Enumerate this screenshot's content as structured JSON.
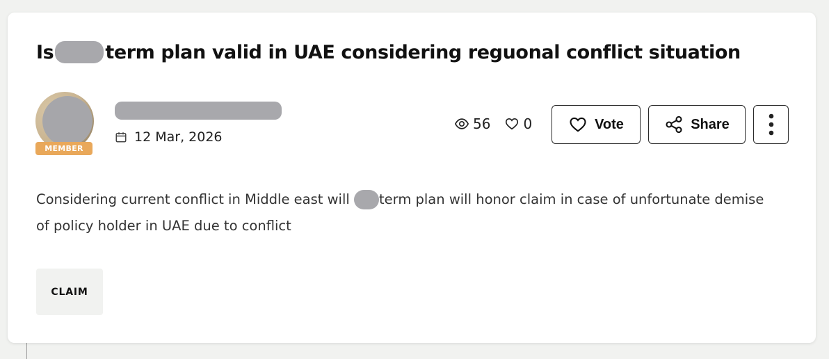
{
  "post": {
    "title_before": "Is",
    "title_after": "term plan valid in UAE considering reguonal conflict situation",
    "author": {
      "badge": "MEMBER"
    },
    "date": "12 Mar, 2026",
    "stats": {
      "views": "56",
      "likes": "0"
    },
    "actions": {
      "vote_label": "Vote",
      "share_label": "Share"
    },
    "body_before": "Considering current conflict in Middle east will",
    "body_after": "term plan will honor claim in case of unfortunate demise of policy holder in UAE due to conflict",
    "tags": [
      "CLAIM"
    ]
  },
  "icons": {
    "calendar": "calendar-icon",
    "views": "eye-icon",
    "likes": "heart-icon",
    "vote": "heart-icon",
    "share": "share-icon",
    "more": "more-vertical-icon"
  },
  "colors": {
    "badge": "#e9a85a",
    "card": "#ffffff",
    "page_bg": "#f1f2f0",
    "tag_bg": "#f1f2f0"
  }
}
